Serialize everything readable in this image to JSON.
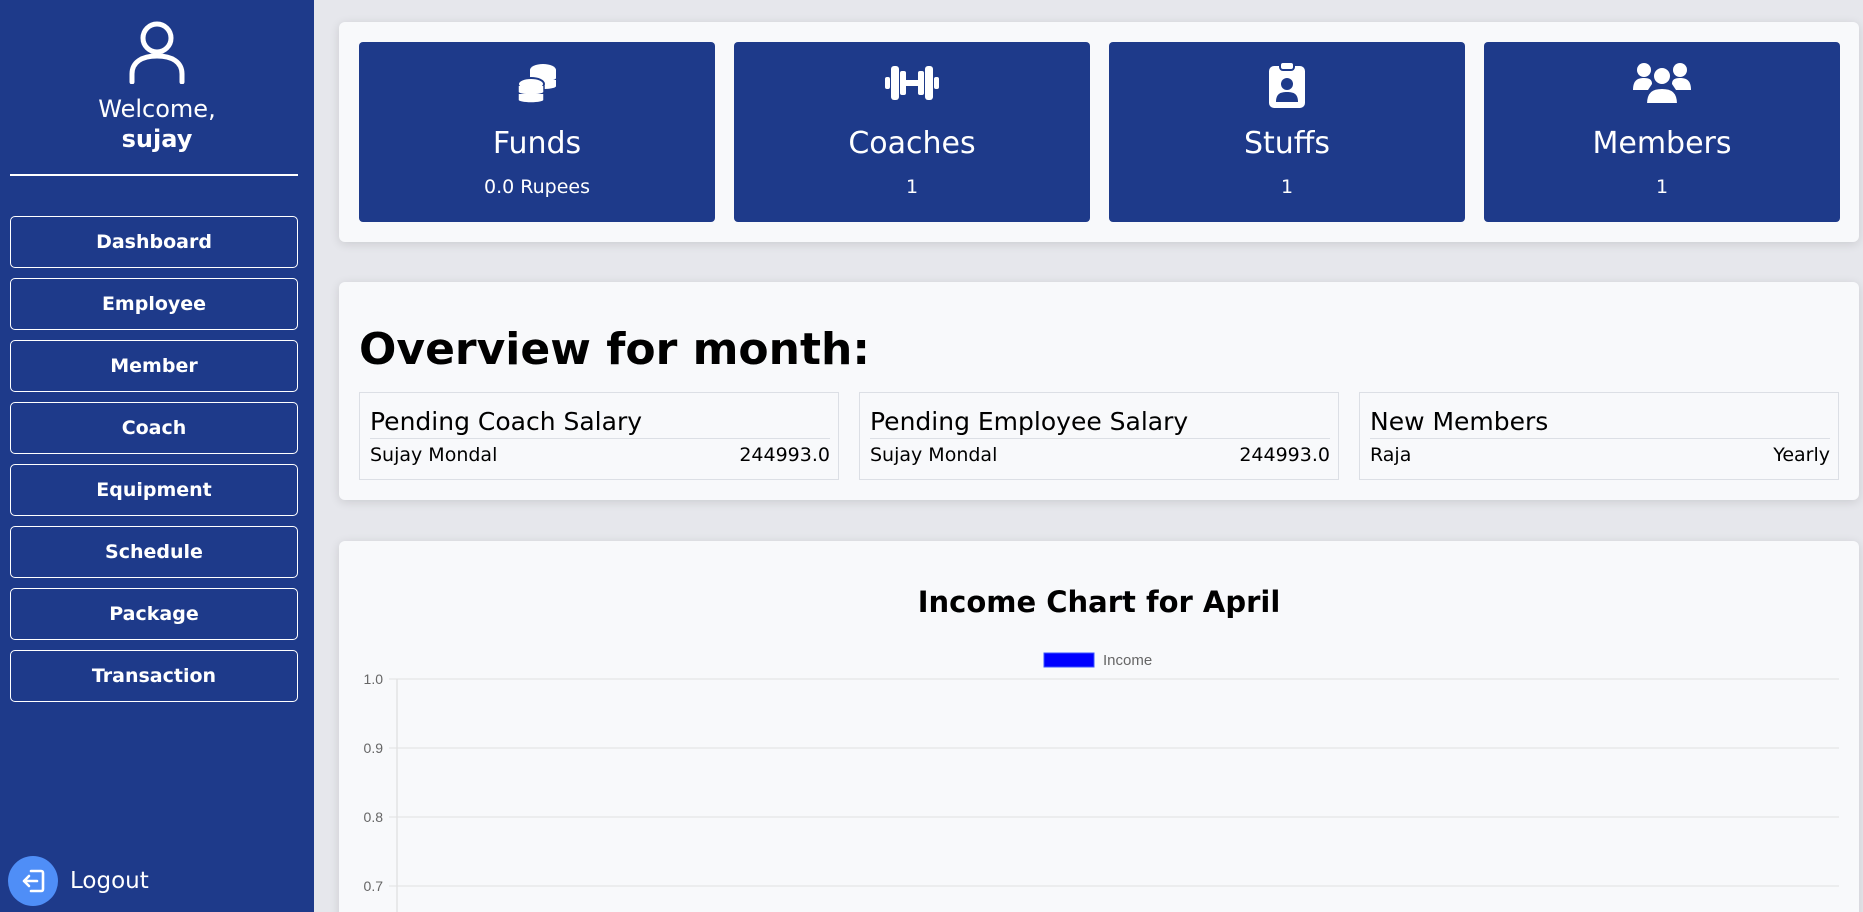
{
  "sidebar": {
    "welcome": "Welcome,",
    "username": "sujay",
    "nav": [
      {
        "label": "Dashboard"
      },
      {
        "label": "Employee"
      },
      {
        "label": "Member"
      },
      {
        "label": "Coach"
      },
      {
        "label": "Equipment"
      },
      {
        "label": "Schedule"
      },
      {
        "label": "Package"
      },
      {
        "label": "Transaction"
      }
    ],
    "logout_label": "Logout",
    "icons": {
      "profile": "user-icon",
      "logout": "logout-icon"
    }
  },
  "stats": [
    {
      "title": "Funds",
      "value": "0.0 Rupees",
      "icon": "coins-icon"
    },
    {
      "title": "Coaches",
      "value": "1",
      "icon": "dumbbell-icon"
    },
    {
      "title": "Stuffs",
      "value": "1",
      "icon": "id-badge-icon"
    },
    {
      "title": "Members",
      "value": "1",
      "icon": "users-icon"
    }
  ],
  "overview": {
    "title": "Overview for month:",
    "boxes": [
      {
        "heading": "Pending Coach Salary",
        "name": "Sujay Mondal",
        "value": "244993.0"
      },
      {
        "heading": "Pending Employee Salary",
        "name": "Sujay Mondal",
        "value": "244993.0"
      },
      {
        "heading": "New Members",
        "name": "Raja",
        "value": "Yearly"
      }
    ]
  },
  "colors": {
    "sidebar": "#1e3a8a",
    "card": "#1e3a8a",
    "logout_button": "#4f8ef7",
    "income_series": "#0000ff",
    "page_background": "#e6e7ec",
    "panel_background": "#f8f9fb"
  },
  "chart_data": {
    "type": "bar",
    "title": "Income Chart for April",
    "series": [
      {
        "name": "Income",
        "values": [],
        "color": "#0000ff"
      }
    ],
    "y_ticks": [
      "1.0",
      "0.9",
      "0.8",
      "0.7"
    ],
    "ylim_visible": [
      0.7,
      1.0
    ],
    "legend": "top-center",
    "grid": true
  }
}
